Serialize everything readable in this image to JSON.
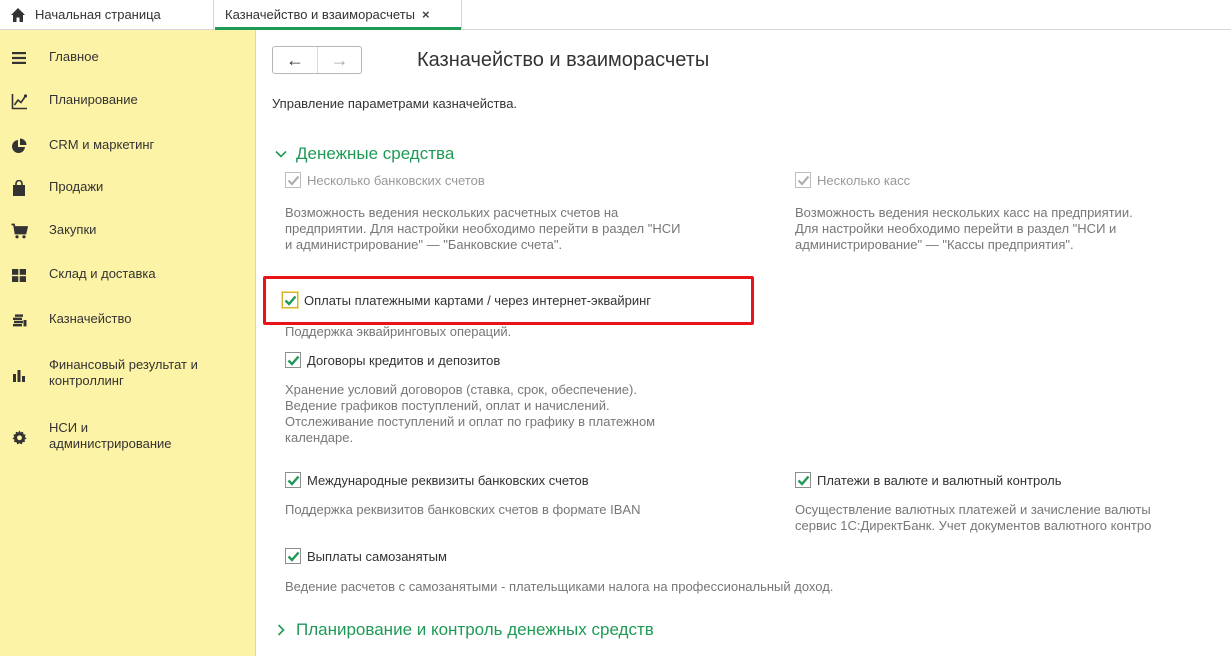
{
  "tabs": {
    "home_label": "Начальная страница",
    "active_label": "Казначейство и взаиморасчеты",
    "close_glyph": "×"
  },
  "sidebar": {
    "items": [
      {
        "label": "Главное",
        "icon": "menu-lines-icon"
      },
      {
        "label": "Планирование",
        "icon": "planning-chart-icon"
      },
      {
        "label": "CRM и маркетинг",
        "icon": "crm-pie-icon"
      },
      {
        "label": "Продажи",
        "icon": "shopping-bag-icon"
      },
      {
        "label": "Закупки",
        "icon": "cart-icon"
      },
      {
        "label": "Склад и доставка",
        "icon": "warehouse-icon"
      },
      {
        "label": "Казначейство",
        "icon": "coins-icon"
      },
      {
        "label": "Финансовый результат и\nконтроллинг",
        "icon": "bar-chart-icon"
      },
      {
        "label": "НСИ и\nадминистрирование",
        "icon": "gear-icon"
      }
    ]
  },
  "main": {
    "back_glyph": "←",
    "forward_glyph": "→",
    "title": "Казначейство и взаиморасчеты",
    "subtitle": "Управление параметрами казначейства.",
    "section_cash": "Денежные средства",
    "section_planning": "Планирование и контроль денежных средств",
    "options": {
      "multi_bank": {
        "label": "Несколько банковских счетов",
        "checked": true,
        "enabled": false,
        "desc": [
          "Возможность ведения нескольких расчетных счетов на",
          "предприятии. Для настройки необходимо перейти в раздел \"НСИ",
          "и администрирование\" — \"Банковские счета\"."
        ]
      },
      "multi_cash": {
        "label": "Несколько касс",
        "checked": true,
        "enabled": false,
        "desc": [
          "Возможность ведения нескольких касс на предприятии.",
          "Для настройки необходимо перейти в раздел \"НСИ и",
          "администрирование\" — \"Кассы предприятия\"."
        ]
      },
      "card_payments": {
        "label": "Оплаты платежными картами / через интернет-эквайринг",
        "checked": true,
        "enabled": true,
        "desc": [
          "Поддержка эквайринговых операций."
        ]
      },
      "loans": {
        "label": "Договоры кредитов и депозитов",
        "checked": true,
        "enabled": true,
        "desc": [
          "Хранение условий договоров (ставка, срок, обеспечение).",
          "Ведение графиков поступлений, оплат и начислений.",
          "Отслеживание поступлений и оплат по графику в платежном",
          "календаре."
        ]
      },
      "iban": {
        "label": "Международные реквизиты банковских счетов",
        "checked": true,
        "enabled": true,
        "desc": [
          "Поддержка реквизитов банковских счетов в формате IBAN"
        ]
      },
      "currency": {
        "label": "Платежи в валюте и валютный контроль",
        "checked": true,
        "enabled": true,
        "desc": [
          "Осуществление валютных платежей и зачисление валюты",
          "сервис 1С:ДиректБанк. Учет документов валютного контро"
        ]
      },
      "self_employed": {
        "label": "Выплаты самозанятым",
        "checked": true,
        "enabled": true,
        "desc": [
          "Ведение расчетов с самозанятыми - плательщиками налога на профессиональный доход."
        ]
      }
    }
  },
  "colors": {
    "sidebar_bg": "#fdf3a6",
    "accent_green": "#1f9a56",
    "highlight_red": "#e8141b"
  }
}
